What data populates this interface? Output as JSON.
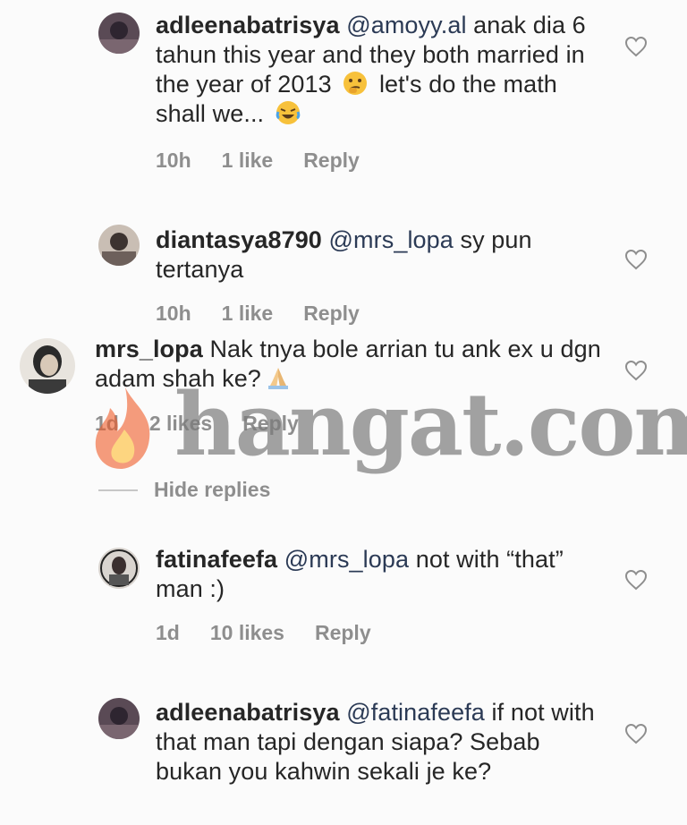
{
  "comments": [
    {
      "username": "adleenabatrisya",
      "mention": "@amoyy.al",
      "text_part1": " anak dia 6 tahun this year and they both married in the year of 2013 ",
      "text_part2": " let's do the math shall we... ",
      "emoji1": "thinking-face-emoji",
      "emoji2": "laughing-tears-emoji",
      "time": "10h",
      "likes": "1 like",
      "reply": "Reply"
    },
    {
      "username": "diantasya8790",
      "mention": "@mrs_lopa",
      "text": " sy pun tertanya",
      "time": "10h",
      "likes": "1 like",
      "reply": "Reply"
    },
    {
      "username": "mrs_lopa",
      "text": " Nak tnya bole arrian tu ank ex u dgn adam shah ke?",
      "emoji1": "praying-hands-emoji",
      "time": "1d",
      "likes": "2 likes",
      "reply": "Reply"
    },
    {
      "username": "fatinafeefa",
      "mention": "@mrs_lopa",
      "text": " not with “that” man :)",
      "time": "1d",
      "likes": "10 likes",
      "reply": "Reply"
    },
    {
      "username": "adleenabatrisya",
      "mention": "@fatinafeefa",
      "text": " if not with that man tapi dengan siapa? Sebab bukan you kahwin sekali je ke?"
    }
  ],
  "hide_replies": "Hide replies",
  "watermark": "hangat.com",
  "colors": {
    "text": "#262626",
    "meta": "#8e8e8e",
    "mention": "#2b3a55",
    "background": "#fbfbfb"
  }
}
